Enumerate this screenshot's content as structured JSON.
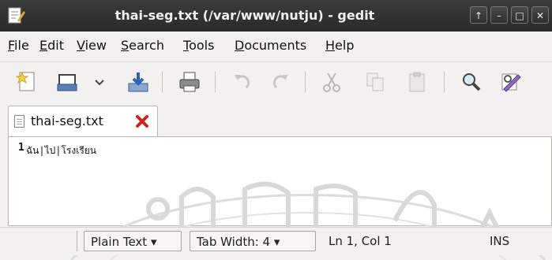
{
  "window": {
    "title": "thai-seg.txt (/var/www/nutju) - gedit",
    "controls": [
      "↑",
      "–",
      "□",
      "✕"
    ]
  },
  "menubar": {
    "items": [
      {
        "ul": "F",
        "rest": "ile"
      },
      {
        "ul": "E",
        "rest": "dit"
      },
      {
        "ul": "V",
        "rest": "iew"
      },
      {
        "ul": "S",
        "rest": "earch"
      },
      {
        "ul": "T",
        "rest": "ools"
      },
      {
        "ul": "D",
        "rest": "ocuments"
      },
      {
        "ul": "H",
        "rest": "elp"
      }
    ]
  },
  "toolbar": {
    "icons": [
      "new-document-icon",
      "open-icon",
      "open-dropdown-icon",
      "save-icon",
      "print-icon",
      "undo-icon",
      "redo-icon",
      "cut-icon",
      "copy-icon",
      "paste-icon",
      "find-icon",
      "replace-icon"
    ]
  },
  "tabs": [
    {
      "label": "thai-seg.txt"
    }
  ],
  "editor": {
    "line_number": "1",
    "text": "ฉัน|ไป|โรงเรียน"
  },
  "statusbar": {
    "language": "Plain Text ▾",
    "tab_width": "Tab Width:  4 ▾",
    "position": "Ln 1, Col 1",
    "mode": "INS"
  },
  "colors": {
    "titlebar": "#2f2f2f",
    "close_x": "#cc2222",
    "watermark": "#d8d8d8"
  }
}
